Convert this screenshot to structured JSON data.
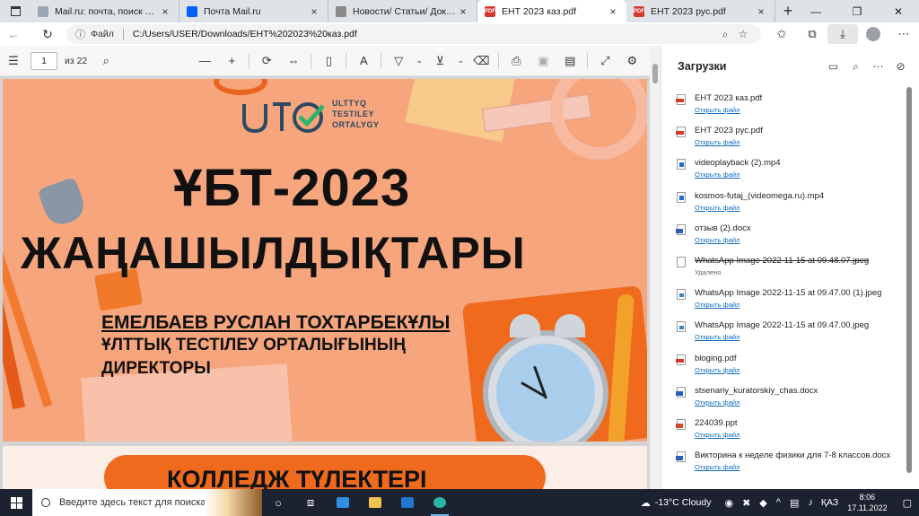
{
  "tabs": [
    {
      "title": "Mail.ru: почта, поиск в интер",
      "close": "×",
      "favicon_color": "#9aa6b2"
    },
    {
      "title": "Почта Mail.ru",
      "close": "×",
      "favicon_color": "#005ff9"
    },
    {
      "title": "Новости/ Статьи/ Документ",
      "close": "×",
      "favicon_color": "#8a8a8a"
    },
    {
      "title": "ЕНТ 2023 каз.pdf",
      "close": "×",
      "favicon_color": "#d7362d",
      "active": true
    },
    {
      "title": "ЕНТ 2023 рус.pdf",
      "close": "×",
      "favicon_color": "#d7362d"
    }
  ],
  "new_tab": "+",
  "window_controls": {
    "minimize": "—",
    "maximize": "❐",
    "close": "✕"
  },
  "address_bar": {
    "label": "Файл",
    "url": "C:/Users/USER/Downloads/ЕНТ%202023%20каз.pdf"
  },
  "pdf_toolbar": {
    "page_current": "1",
    "page_count": "из 22"
  },
  "pdf_page1": {
    "logo_lines": [
      "ULTTYQ",
      "TESTILEY",
      "ORTALYGY"
    ],
    "title_line1": "ҰБТ-2023",
    "title_line2": "ЖАҢАШЫЛДЫҚТАРЫ",
    "author": "ЕМЕЛБАЕВ РУСЛАН ТОХТАРБЕКҰЛЫ",
    "role_line1": "ҰЛТТЫҚ ТЕСТІЛЕУ ОРТАЛЫҒЫНЫҢ",
    "role_line2": "ДИРЕКТОРЫ"
  },
  "pdf_page2": {
    "banner": "КОЛЛЕДЖ ТҮЛЕКТЕРІ"
  },
  "downloads": {
    "title": "Загрузки",
    "items": [
      {
        "name": "ЕНТ 2023 каз.pdf",
        "action": "Открыть файл",
        "type": "pdf"
      },
      {
        "name": "ЕНТ 2023 рус.pdf",
        "action": "Открыть файл",
        "type": "pdf"
      },
      {
        "name": "videoplayback (2).mp4",
        "action": "Открыть файл",
        "type": "vid"
      },
      {
        "name": "kosmos-futaj_(videomega.ru).mp4",
        "action": "Открыть файл",
        "type": "vid"
      },
      {
        "name": "отзыв (2).docx",
        "action": "Открыть файл",
        "type": "doc"
      },
      {
        "name": "WhatsApp Image 2022-11-15 at 09.48.07.jpeg",
        "status": "Удалено",
        "type": "img",
        "deleted": true
      },
      {
        "name": "WhatsApp Image 2022-11-15 at 09.47.00 (1).jpeg",
        "action": "Открыть файл",
        "type": "img"
      },
      {
        "name": "WhatsApp Image 2022-11-15 at 09.47.00.jpeg",
        "action": "Открыть файл",
        "type": "img"
      },
      {
        "name": "bloging.pdf",
        "action": "Открыть файл",
        "type": "pdf"
      },
      {
        "name": "stsenariy_kuratorskiy_chas.docx",
        "action": "Открыть файл",
        "type": "doc"
      },
      {
        "name": "224039.ppt",
        "action": "Открыть файл",
        "type": "ppt"
      },
      {
        "name": "Викторина к неделе физики для 7-8 классов.docx",
        "action": "Открыть файл",
        "type": "doc"
      }
    ]
  },
  "taskbar": {
    "search_placeholder": "Введите здесь текст для поиска",
    "weather": "-13°C  Cloudy",
    "language": "ҚАЗ",
    "time": "8:06",
    "date": "17.11.2022"
  }
}
